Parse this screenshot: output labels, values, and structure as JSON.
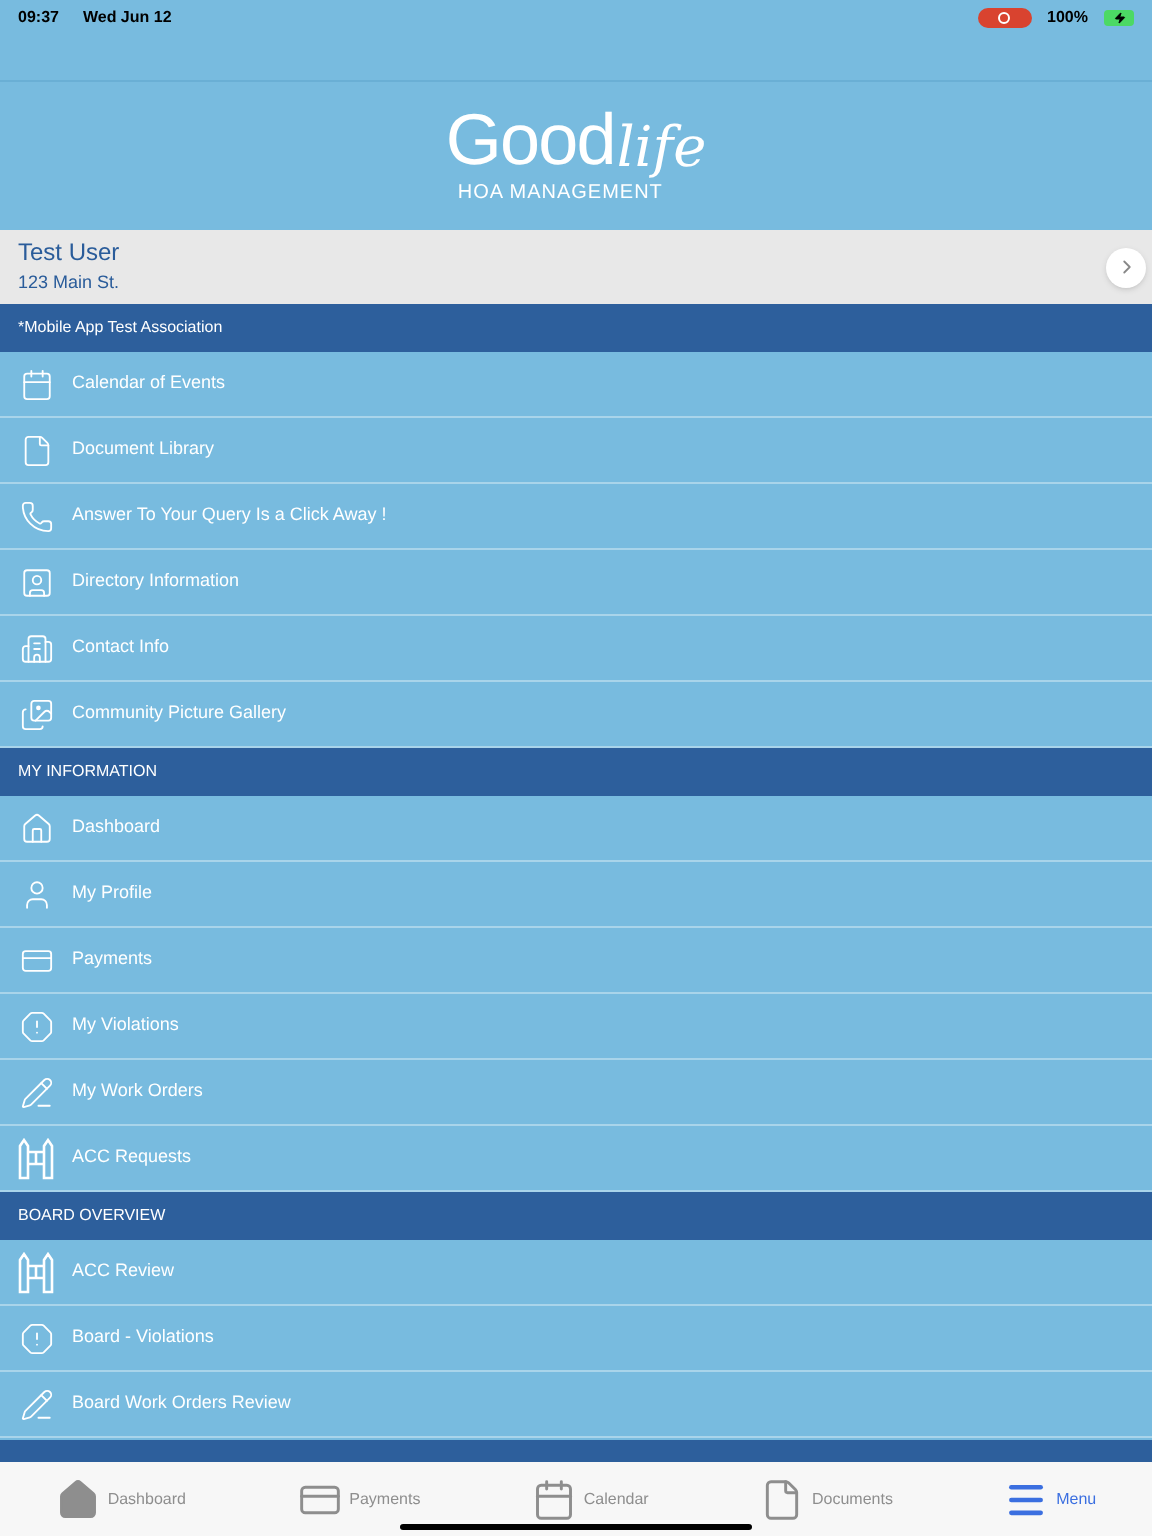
{
  "status_bar": {
    "time": "09:37",
    "date": "Wed Jun 12",
    "battery": "100%"
  },
  "logo": {
    "brand_main": "Good",
    "brand_script": "life",
    "tagline": "HOA MANAGEMENT"
  },
  "user": {
    "name": "Test User",
    "address": "123 Main St."
  },
  "sections": [
    {
      "title": "*Mobile App Test Association",
      "items": [
        "Calendar of Events",
        "Document Library",
        "Answer To Your Query Is a Click Away !",
        "Directory Information",
        "Contact Info",
        "Community Picture Gallery"
      ]
    },
    {
      "title": "MY INFORMATION",
      "items": [
        "Dashboard",
        "My Profile",
        "Payments",
        "My Violations",
        "My Work Orders",
        "ACC Requests"
      ]
    },
    {
      "title": "BOARD OVERVIEW",
      "items": [
        "ACC Review",
        "Board - Violations",
        "Board Work Orders Review"
      ]
    }
  ],
  "tabs": [
    {
      "label": "Dashboard",
      "selected": false
    },
    {
      "label": "Payments",
      "selected": false
    },
    {
      "label": "Calendar",
      "selected": false
    },
    {
      "label": "Documents",
      "selected": false
    },
    {
      "label": "Menu",
      "selected": true
    }
  ]
}
